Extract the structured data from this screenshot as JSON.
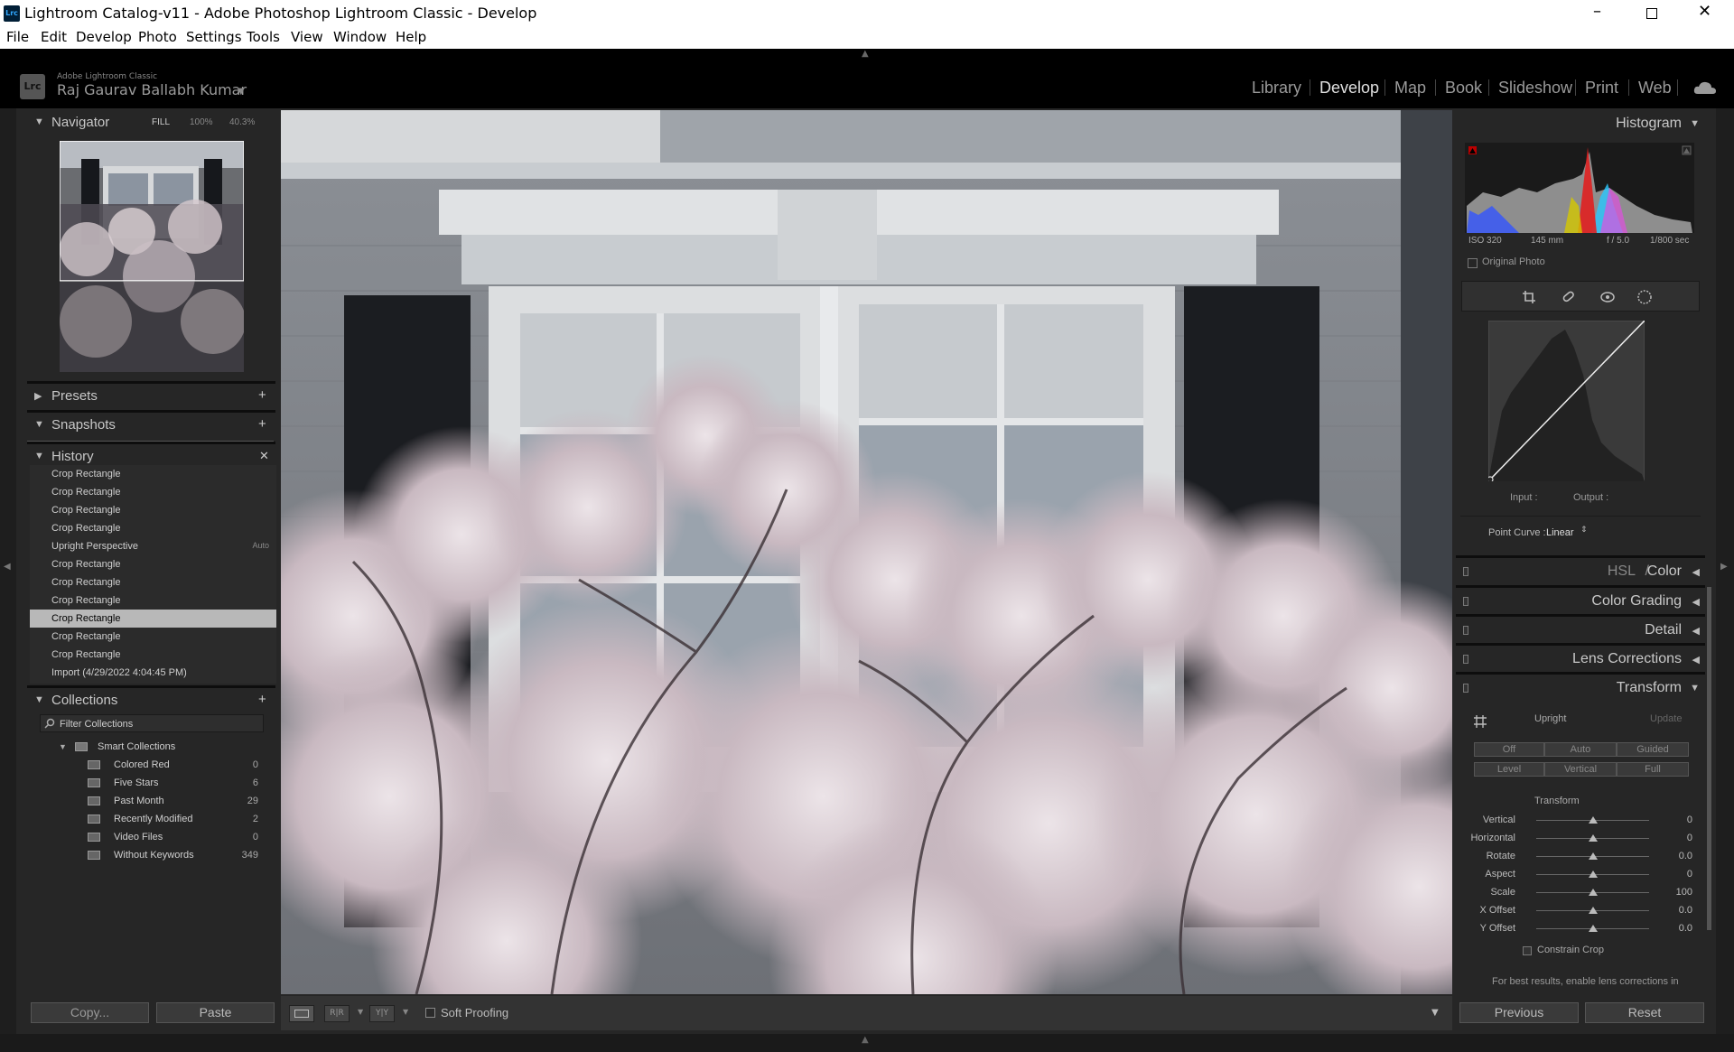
{
  "window": {
    "title": "Lightroom Catalog-v11 - Adobe Photoshop Lightroom Classic - Develop",
    "app_badge": "Lrc"
  },
  "menu": [
    "File",
    "Edit",
    "Develop",
    "Photo",
    "Settings",
    "Tools",
    "View",
    "Window",
    "Help"
  ],
  "identity": {
    "product": "Adobe Lightroom Classic",
    "user": "Raj Gaurav Ballabh Kumar"
  },
  "modules": [
    "Library",
    "Develop",
    "Map",
    "Book",
    "Slideshow",
    "Print",
    "Web"
  ],
  "active_module": "Develop",
  "navigator": {
    "title": "Navigator",
    "fill": "FILL",
    "z1": "100%",
    "z2": "40.3%"
  },
  "presets": {
    "title": "Presets"
  },
  "snapshots": {
    "title": "Snapshots"
  },
  "history": {
    "title": "History",
    "items": [
      {
        "label": "Crop Rectangle",
        "extra": ""
      },
      {
        "label": "Crop Rectangle",
        "extra": ""
      },
      {
        "label": "Crop Rectangle",
        "extra": ""
      },
      {
        "label": "Crop Rectangle",
        "extra": ""
      },
      {
        "label": "Upright Perspective",
        "extra": "Auto"
      },
      {
        "label": "Crop Rectangle",
        "extra": ""
      },
      {
        "label": "Crop Rectangle",
        "extra": ""
      },
      {
        "label": "Crop Rectangle",
        "extra": ""
      },
      {
        "label": "Crop Rectangle",
        "extra": ""
      },
      {
        "label": "Crop Rectangle",
        "extra": ""
      },
      {
        "label": "Crop Rectangle",
        "extra": ""
      },
      {
        "label": "Import (4/29/2022 4:04:45 PM)",
        "extra": ""
      }
    ],
    "selected_index": 8
  },
  "collections": {
    "title": "Collections",
    "filter_placeholder": "Filter Collections",
    "group": "Smart Collections",
    "items": [
      {
        "name": "Colored Red",
        "count": "0"
      },
      {
        "name": "Five Stars",
        "count": "6"
      },
      {
        "name": "Past Month",
        "count": "29"
      },
      {
        "name": "Recently Modified",
        "count": "2"
      },
      {
        "name": "Video Files",
        "count": "0"
      },
      {
        "name": "Without Keywords",
        "count": "349"
      }
    ]
  },
  "left_buttons": {
    "copy": "Copy...",
    "paste": "Paste"
  },
  "toolbar": {
    "soft_proofing": "Soft Proofing"
  },
  "histogram": {
    "title": "Histogram",
    "iso": "ISO 320",
    "focal": "145 mm",
    "aperture": "f / 5.0",
    "shutter": "1/800 sec",
    "original": "Original Photo"
  },
  "tone_curve": {
    "input": "Input :",
    "output": "Output :",
    "point_curve_label": "Point Curve :",
    "point_curve_value": "Linear"
  },
  "right_panels": {
    "hsl": "HSL",
    "hsl_sep": "/",
    "color": "Color",
    "color_grading": "Color Grading",
    "detail": "Detail",
    "lens": "Lens Corrections",
    "transform": "Transform"
  },
  "transform": {
    "upright": "Upright",
    "update": "Update",
    "row1": [
      "Off",
      "Auto",
      "Guided"
    ],
    "row2": [
      "Level",
      "Vertical",
      "Full"
    ],
    "section": "Transform",
    "sliders": [
      {
        "label": "Vertical",
        "value": "0",
        "pos": 0.5
      },
      {
        "label": "Horizontal",
        "value": "0",
        "pos": 0.5
      },
      {
        "label": "Rotate",
        "value": "0.0",
        "pos": 0.5
      },
      {
        "label": "Aspect",
        "value": "0",
        "pos": 0.5
      },
      {
        "label": "Scale",
        "value": "100",
        "pos": 0.5
      },
      {
        "label": "X Offset",
        "value": "0.0",
        "pos": 0.5
      },
      {
        "label": "Y Offset",
        "value": "0.0",
        "pos": 0.5
      }
    ],
    "constrain": "Constrain Crop",
    "note": "For best results, enable lens corrections in"
  },
  "right_buttons": {
    "previous": "Previous",
    "reset": "Reset"
  },
  "colors": {
    "bg": "#262626",
    "selected_row": "#b8b8b8",
    "black": "#000000"
  }
}
